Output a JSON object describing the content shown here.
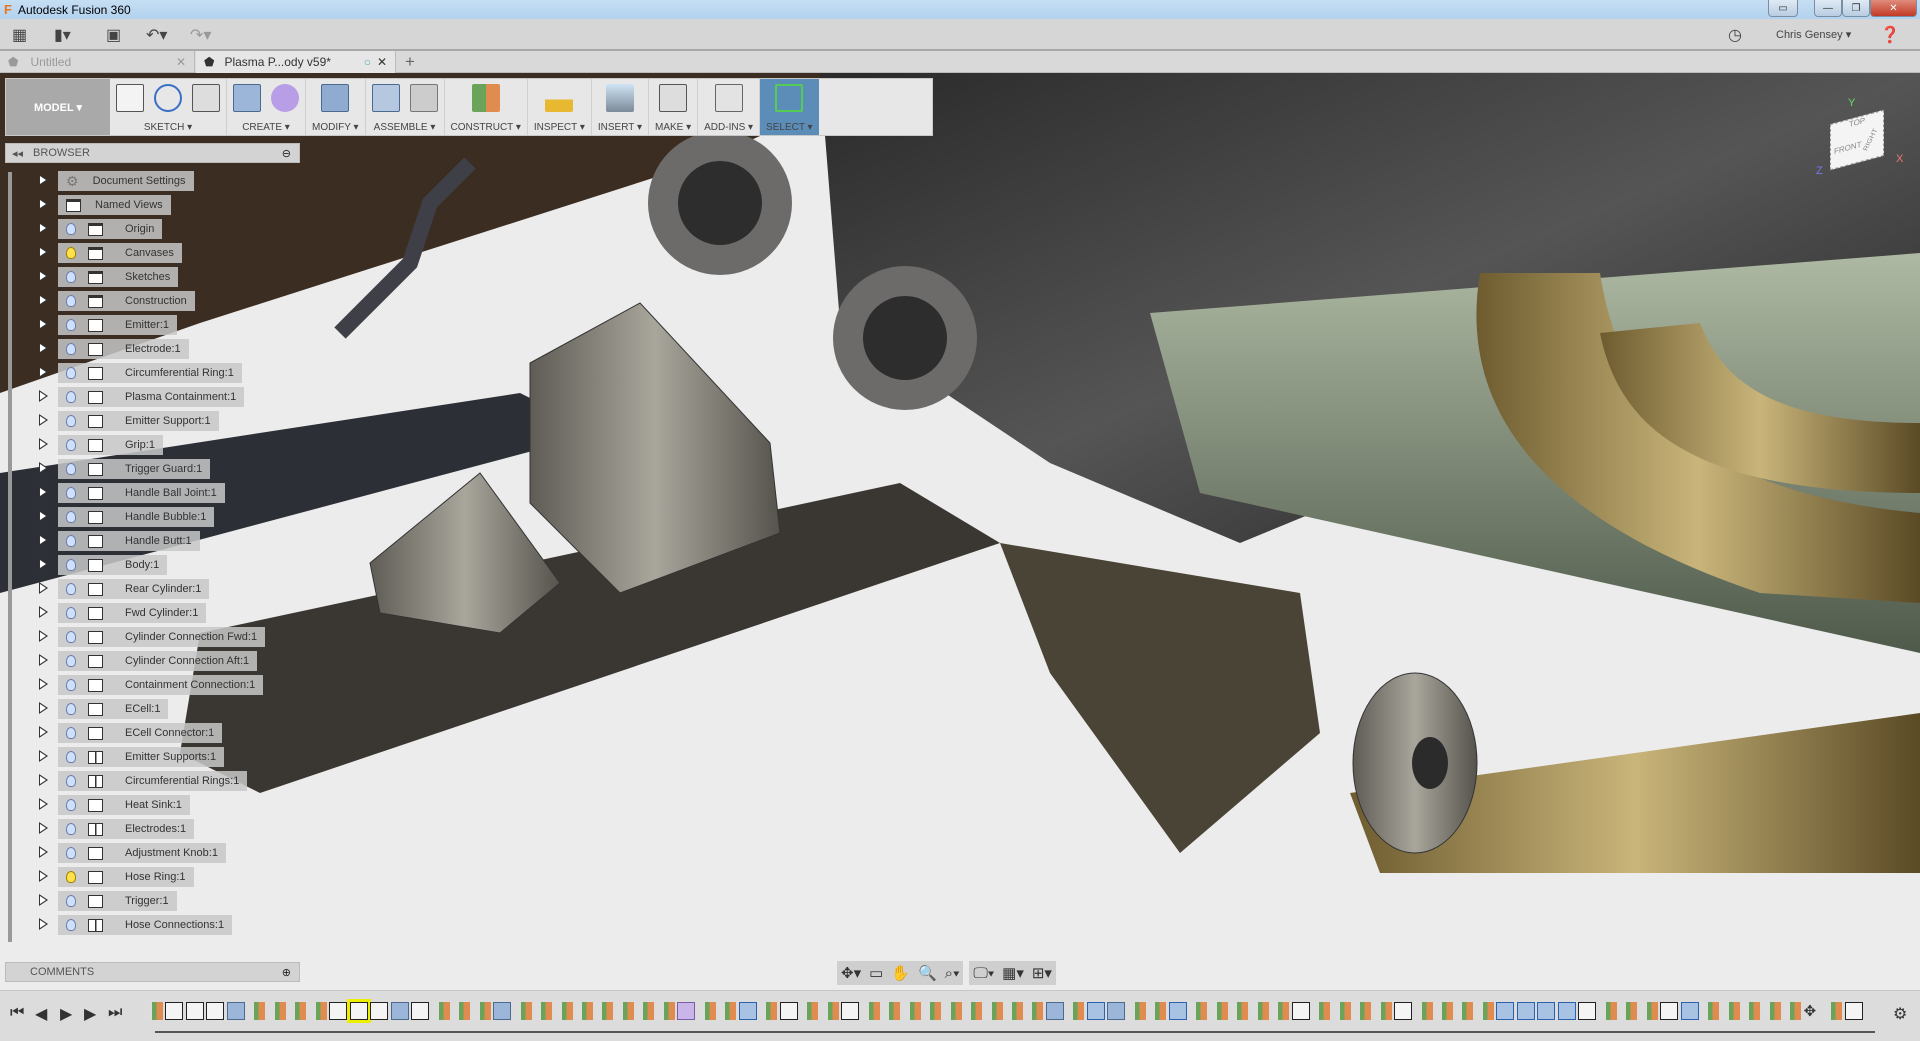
{
  "window": {
    "title": "Autodesk Fusion 360",
    "logo": "F",
    "buttons": [
      "restore-down-icon",
      "minimize-icon",
      "maximize-icon",
      "close-icon"
    ]
  },
  "menubar": {
    "user": "Chris Gensey ▾",
    "icons": [
      "apps-grid-icon",
      "file-icon",
      "save-icon",
      "undo-icon",
      "redo-icon",
      "job-status-icon",
      "help-icon"
    ]
  },
  "tabs": [
    {
      "label": "Untitled",
      "active": false
    },
    {
      "label": "Plasma P...ody v59*",
      "active": true
    }
  ],
  "toolbar": {
    "workspace": "MODEL ▾",
    "groups": [
      {
        "label": "SKETCH ▾",
        "icons": [
          "create-sketch-icon",
          "spline-icon",
          "rectangle-icon"
        ]
      },
      {
        "label": "CREATE ▾",
        "icons": [
          "extrude-icon",
          "sculpt-form-icon"
        ]
      },
      {
        "label": "MODIFY ▾",
        "icons": [
          "press-pull-icon"
        ]
      },
      {
        "label": "ASSEMBLE ▾",
        "icons": [
          "new-component-icon",
          "joint-icon"
        ]
      },
      {
        "label": "CONSTRUCT ▾",
        "icons": [
          "offset-plane-icon"
        ]
      },
      {
        "label": "INSPECT ▾",
        "icons": [
          "measure-icon"
        ]
      },
      {
        "label": "INSERT ▾",
        "icons": [
          "insert-image-icon"
        ]
      },
      {
        "label": "MAKE ▾",
        "icons": [
          "3d-print-icon"
        ]
      },
      {
        "label": "ADD-INS ▾",
        "icons": [
          "scripts-icon"
        ]
      },
      {
        "label": "SELECT ▾",
        "icons": [
          "select-icon"
        ]
      }
    ]
  },
  "browser": {
    "title": "BROWSER",
    "items": [
      {
        "label": "Document Settings",
        "icon": "gear",
        "bulb": null
      },
      {
        "label": "Named Views",
        "icon": "folder",
        "bulb": null
      },
      {
        "label": "Origin",
        "icon": "folder",
        "bulb": "off"
      },
      {
        "label": "Canvases",
        "icon": "folder",
        "bulb": "on"
      },
      {
        "label": "Sketches",
        "icon": "folder",
        "bulb": "off"
      },
      {
        "label": "Construction",
        "icon": "folder",
        "bulb": "off"
      },
      {
        "label": "Emitter:1",
        "icon": "component",
        "bulb": "off"
      },
      {
        "label": "Electrode:1",
        "icon": "component",
        "bulb": "off"
      },
      {
        "label": "Circumferential Ring:1",
        "icon": "component",
        "bulb": "off"
      },
      {
        "label": "Plasma Containment:1",
        "icon": "component",
        "bulb": "off"
      },
      {
        "label": "Emitter Support:1",
        "icon": "component",
        "bulb": "off"
      },
      {
        "label": "Grip:1",
        "icon": "component",
        "bulb": "off"
      },
      {
        "label": "Trigger Guard:1",
        "icon": "component",
        "bulb": "off"
      },
      {
        "label": "Handle Ball Joint:1",
        "icon": "component",
        "bulb": "off"
      },
      {
        "label": "Handle Bubble:1",
        "icon": "component",
        "bulb": "off"
      },
      {
        "label": "Handle Butt:1",
        "icon": "component",
        "bulb": "off"
      },
      {
        "label": "Body:1",
        "icon": "component",
        "bulb": "off"
      },
      {
        "label": "Rear Cylinder:1",
        "icon": "component",
        "bulb": "off"
      },
      {
        "label": "Fwd Cylinder:1",
        "icon": "component",
        "bulb": "off"
      },
      {
        "label": "Cylinder Connection Fwd:1",
        "icon": "component",
        "bulb": "off"
      },
      {
        "label": "Cylinder Connection Aft:1",
        "icon": "component",
        "bulb": "off"
      },
      {
        "label": "Containment Connection:1",
        "icon": "component",
        "bulb": "off"
      },
      {
        "label": "ECell:1",
        "icon": "component",
        "bulb": "off"
      },
      {
        "label": "ECell Connector:1",
        "icon": "component",
        "bulb": "off"
      },
      {
        "label": "Emitter Supports:1",
        "icon": "assembly",
        "bulb": "off"
      },
      {
        "label": "Circumferential Rings:1",
        "icon": "assembly",
        "bulb": "off"
      },
      {
        "label": "Heat Sink:1",
        "icon": "component",
        "bulb": "off"
      },
      {
        "label": "Electrodes:1",
        "icon": "assembly",
        "bulb": "off"
      },
      {
        "label": "Adjustment Knob:1",
        "icon": "component",
        "bulb": "off"
      },
      {
        "label": "Hose Ring:1",
        "icon": "component",
        "bulb": "on"
      },
      {
        "label": "Trigger:1",
        "icon": "component",
        "bulb": "off"
      },
      {
        "label": "Hose Connections:1",
        "icon": "assembly",
        "bulb": "off"
      }
    ]
  },
  "comments": {
    "title": "COMMENTS"
  },
  "viewcube": {
    "faces": [
      "TOP",
      "FRONT",
      "RIGHT"
    ],
    "axes": [
      "X",
      "Y",
      "Z"
    ]
  },
  "navbar": {
    "icons": [
      "orbit-icon",
      "look-at-icon",
      "pan-icon",
      "zoom-icon",
      "fit-icon",
      "display-settings-icon",
      "grid-icon",
      "viewports-icon"
    ]
  },
  "timeline": {
    "controls": [
      "skip-start-icon",
      "step-back-icon",
      "play-icon",
      "step-forward-icon",
      "skip-end-icon",
      "settings-icon"
    ],
    "features": "SKKKEPPPPKKKEKPPPEPPPPPPPPFPPCPKPPKPPPPPPPPPEPCEPPCPPPPPKPPPPKPPPPCCCCKPPPKCPPPPPMPK"
  },
  "colors": {
    "accent": "#4a7fb0",
    "select_active": "#5b8db8"
  }
}
